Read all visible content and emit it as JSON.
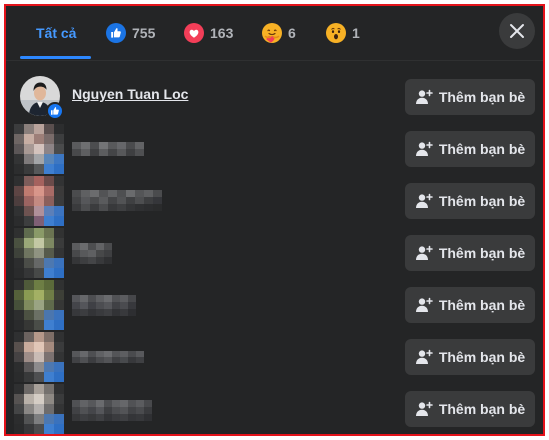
{
  "tabs": [
    {
      "id": "all",
      "label": "Tất cả",
      "active": true
    },
    {
      "id": "like",
      "icon": "like-reaction-icon",
      "count": "755"
    },
    {
      "id": "love",
      "icon": "love-reaction-icon",
      "count": "163"
    },
    {
      "id": "care",
      "icon": "care-reaction-icon",
      "count": "6"
    },
    {
      "id": "wow",
      "icon": "wow-reaction-icon",
      "count": "1"
    }
  ],
  "close_icon": "close-icon",
  "add_friend_label": "Thêm bạn bè",
  "people": [
    {
      "name": "Nguyen Tuan Loc",
      "reaction": "like",
      "blurred": false
    },
    {
      "name": "",
      "reaction": "like",
      "blurred": true
    },
    {
      "name": "",
      "reaction": "like",
      "blurred": true
    },
    {
      "name": "",
      "reaction": "like",
      "blurred": true
    },
    {
      "name": "",
      "reaction": "like",
      "blurred": true
    },
    {
      "name": "",
      "reaction": "like",
      "blurred": true
    },
    {
      "name": "",
      "reaction": "like",
      "blurred": true
    }
  ],
  "colors": {
    "background": "#242526",
    "button": "#3a3b3c",
    "accent": "#2d88ff",
    "text": "#e4e6eb",
    "muted": "#b0b3b8",
    "frame_border": "#e4131b"
  }
}
